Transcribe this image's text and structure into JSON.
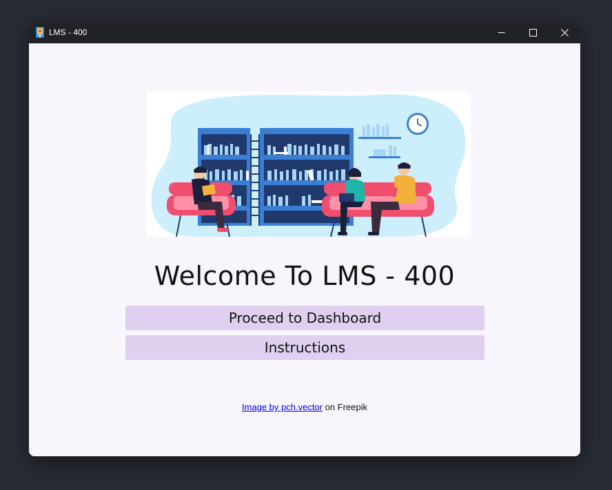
{
  "window": {
    "title": "LMS - 400",
    "controls": {
      "minimize": "minimize",
      "maximize": "maximize",
      "close": "close"
    }
  },
  "main": {
    "hero_image": {
      "icon": "library-illustration",
      "alt": ""
    },
    "welcome_text": "Welcome To LMS - 400",
    "buttons": {
      "dashboard_label": "Proceed to Dashboard",
      "instructions_label": "Instructions"
    },
    "credit": {
      "link_text": "Image by pch.vector",
      "suffix_text": " on Freepik"
    }
  },
  "colors": {
    "background": "#272b33",
    "titlebar": "#202226",
    "window_bg": "#f8f5fc",
    "button_bg": "#dfd0ef",
    "link": "#0000ee"
  }
}
